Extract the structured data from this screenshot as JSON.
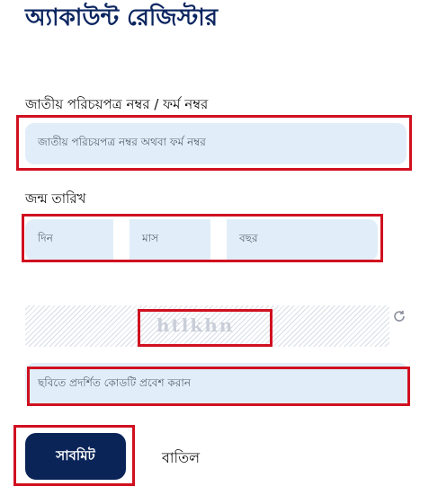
{
  "page_title": "অ্যাকাউন্ট রেজিস্টার",
  "nid_field": {
    "label": "জাতীয় পরিচয়পত্র নম্বর / ফর্ম নম্বর",
    "placeholder": "জাতীয় পরিচয়পত্র নম্বর অথবা ফর্ম নম্বর"
  },
  "dob_field": {
    "label": "জন্ম তারিখ",
    "day_placeholder": "দিন",
    "month_placeholder": "মাস",
    "year_placeholder": "বছর"
  },
  "captcha": {
    "code": "htlkhn",
    "refresh_icon": "refresh-icon",
    "input_placeholder": "ছবিতে প্রদর্শিত কোডটি প্রবেশ করান"
  },
  "actions": {
    "submit_label": "সাবমিট",
    "cancel_label": "বাতিল"
  },
  "colors": {
    "brand": "#0a2458",
    "input_bg": "#e1eef9",
    "highlight": "#d01020"
  }
}
